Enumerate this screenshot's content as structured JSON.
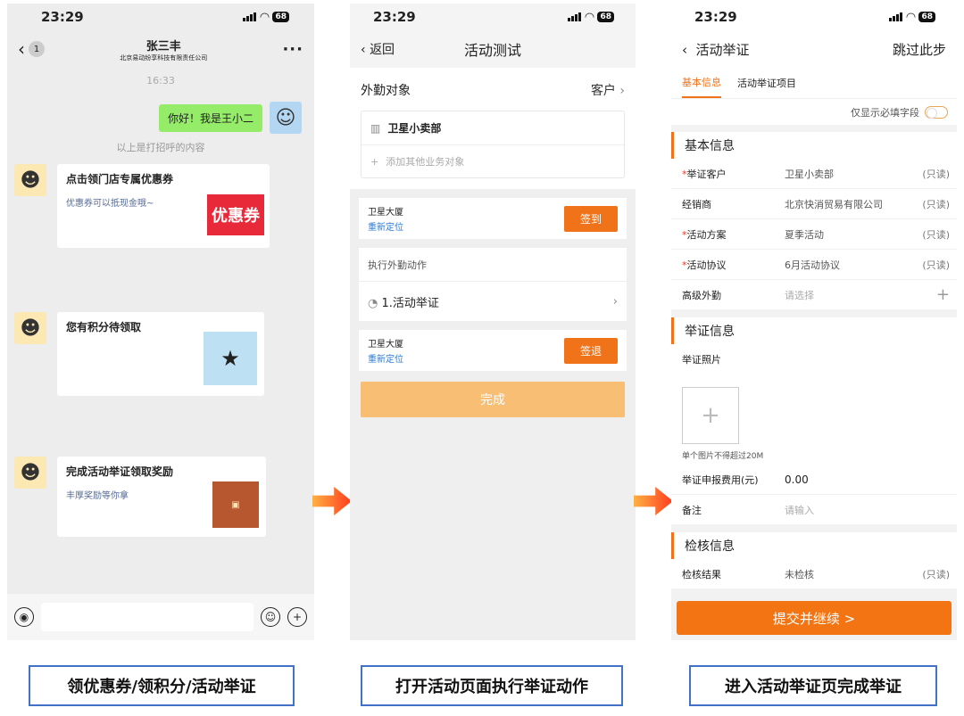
{
  "status": {
    "time": "23:29",
    "battery": "68"
  },
  "p1": {
    "badge": "1",
    "contact": "张三丰",
    "company": "北京易动纷享科技有限责任公司",
    "more": "···",
    "time": "16:33",
    "greeting": "你好！我是王小二",
    "sys": "以上是打招呼的内容",
    "cards": [
      {
        "title": "点击领门店专属优惠券",
        "desc": "优惠券可以抵现金哦~",
        "img": "优惠券"
      },
      {
        "title": "您有积分待领取",
        "desc": ""
      },
      {
        "title": "完成活动举证领取奖励",
        "desc": "丰厚奖励等你拿"
      }
    ]
  },
  "p2": {
    "back": "返回",
    "title": "活动测试",
    "target_label": "外勤对象",
    "target_value": "客户",
    "store": "卫星小卖部",
    "add_placeholder": "添加其他业务对象",
    "loc_name": "卫星大厦",
    "relocate": "重新定位",
    "signin": "签到",
    "section": "执行外勤动作",
    "action": "1.活动举证",
    "signout": "签退",
    "done": "完成"
  },
  "p3": {
    "title": "活动举证",
    "skip": "跳过此步",
    "tabs": [
      "基本信息",
      "活动举证项目"
    ],
    "toggle_label": "仅显示必填字段",
    "sec1": "基本信息",
    "fields": [
      {
        "req": "*",
        "label": "举证客户",
        "value": "卫星小卖部",
        "ro": "(只读)"
      },
      {
        "req": "",
        "label": "经销商",
        "value": "北京快消贸易有限公司",
        "ro": "(只读)"
      },
      {
        "req": "*",
        "label": "活动方案",
        "value": "夏季活动",
        "ro": "(只读)"
      },
      {
        "req": "*",
        "label": "活动协议",
        "value": "6月活动协议",
        "ro": "(只读)"
      },
      {
        "req": "",
        "label": "高级外勤",
        "value": "请选择",
        "ro": "+"
      }
    ],
    "sec2": "举证信息",
    "photo_label": "举证照片",
    "photo_note": "单个图片不得超过20M",
    "fee_label": "举证申报费用(元)",
    "fee_value": "0.00",
    "remark_label": "备注",
    "remark_placeholder": "请输入",
    "sec3": "检核信息",
    "check_label": "检核结果",
    "check_value": "未检核",
    "check_ro": "(只读)",
    "submit": "提交并继续 >"
  },
  "captions": [
    "领优惠券/领积分/活动举证",
    "打开活动页面执行举证动作",
    "进入活动举证页完成举证"
  ]
}
